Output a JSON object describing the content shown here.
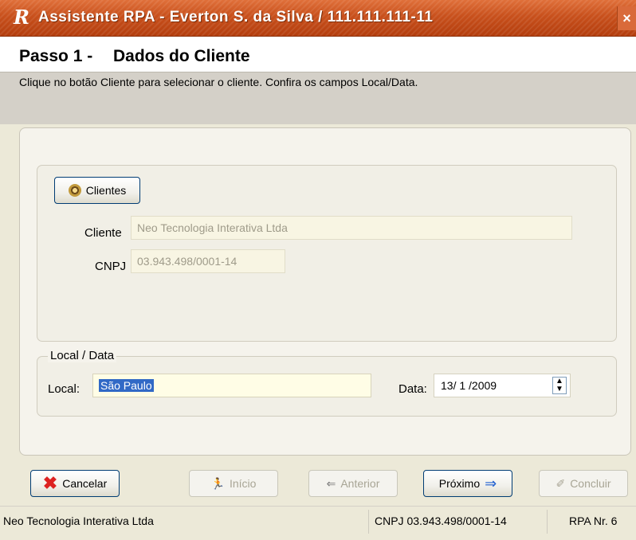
{
  "window": {
    "logo": "R",
    "title": "Assistente RPA - Everton S. da Silva / 111.111.111-11",
    "close_glyph": "×"
  },
  "header": {
    "step": "Passo 1 -",
    "step_title": "Dados do Cliente",
    "instruction": "Clique no botão Cliente para selecionar o cliente. Confira os campos Local/Data."
  },
  "client_section": {
    "button_label": "Clientes",
    "button_icon": "gear-icon",
    "cliente_label": "Cliente",
    "cliente_value": "Neo Tecnologia Interativa Ltda",
    "cnpj_label": "CNPJ",
    "cnpj_value": "03.943.498/0001-14"
  },
  "local_data": {
    "legend": "Local / Data",
    "local_label": "Local:",
    "local_value": "São Paulo",
    "data_label": "Data:",
    "data_value": "13/ 1 /2009"
  },
  "buttons": {
    "cancel": "Cancelar",
    "start": "Início",
    "previous": "Anterior",
    "next": "Próximo",
    "finish": "Concluir"
  },
  "status": {
    "company": "Neo Tecnologia Interativa Ltda",
    "cnpj": "CNPJ 03.943.498/0001-14",
    "rpa": "RPA Nr. 6"
  }
}
